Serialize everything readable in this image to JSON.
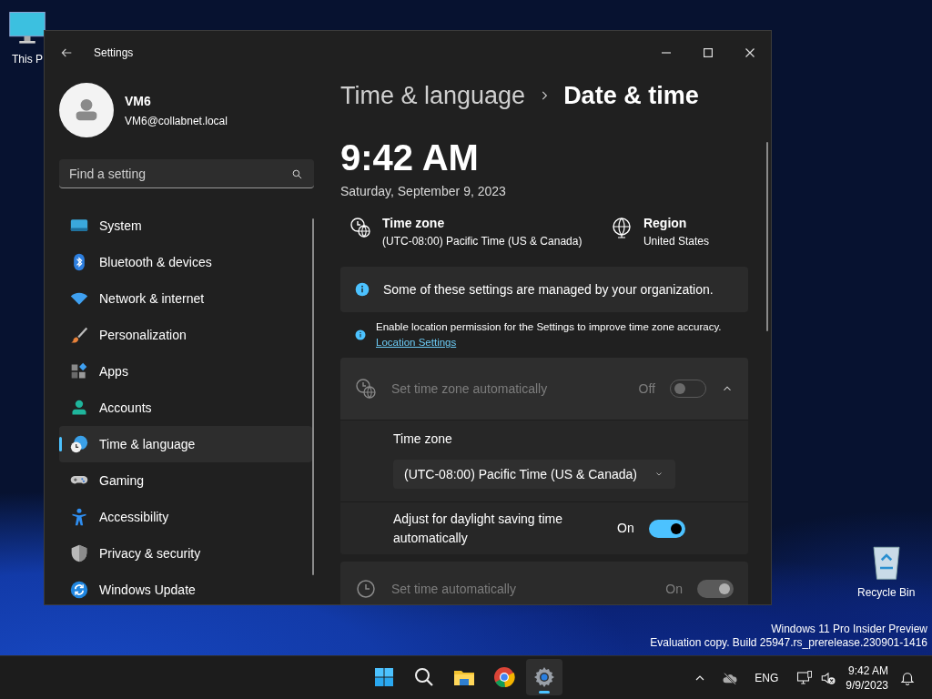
{
  "desktop": {
    "icons": [
      {
        "kind": "computer",
        "label": "This P"
      },
      {
        "kind": "recycle-bin",
        "label": "Recycle Bin"
      }
    ],
    "watermark": [
      "Windows 11 Pro Insider Preview",
      "Evaluation copy. Build 25947.rs_prerelease.230901-1416"
    ]
  },
  "window": {
    "title": "Settings",
    "account": {
      "name": "VM6",
      "email": "VM6@collabnet.local"
    },
    "search": {
      "placeholder": "Find a setting"
    },
    "nav": [
      {
        "kind": "system",
        "label": "System",
        "selected": false
      },
      {
        "kind": "bluetooth",
        "label": "Bluetooth & devices",
        "selected": false
      },
      {
        "kind": "network",
        "label": "Network & internet",
        "selected": false
      },
      {
        "kind": "personalization",
        "label": "Personalization",
        "selected": false
      },
      {
        "kind": "apps",
        "label": "Apps",
        "selected": false
      },
      {
        "kind": "accounts",
        "label": "Accounts",
        "selected": false
      },
      {
        "kind": "time",
        "label": "Time & language",
        "selected": true
      },
      {
        "kind": "gaming",
        "label": "Gaming",
        "selected": false
      },
      {
        "kind": "accessibility",
        "label": "Accessibility",
        "selected": false
      },
      {
        "kind": "privacy",
        "label": "Privacy & security",
        "selected": false
      },
      {
        "kind": "update",
        "label": "Windows Update",
        "selected": false
      }
    ],
    "page": {
      "breadcrumb": [
        "Time & language",
        "Date & time"
      ],
      "time": "9:42 AM",
      "date": "Saturday, September 9, 2023",
      "summary": [
        {
          "kind": "time-zone",
          "title": "Time zone",
          "value": "(UTC-08:00) Pacific Time (US & Canada)"
        },
        {
          "kind": "region",
          "title": "Region",
          "value": "United States"
        }
      ],
      "notice": "Some of these settings are managed by your organization.",
      "location_notice": {
        "text": "Enable location permission for the Settings to improve time zone accuracy.",
        "link": "Location Settings"
      },
      "settings": [
        {
          "kind": "expander",
          "label": "Set time zone automatically",
          "state_label": "Off",
          "on": false,
          "disabled": true,
          "expanded": true,
          "children": [
            {
              "kind": "dropdown",
              "label": "Time zone",
              "value": "(UTC-08:00) Pacific Time (US & Canada)"
            },
            {
              "kind": "toggle",
              "label": "Adjust for daylight saving time automatically",
              "state_label": "On",
              "on": true,
              "disabled": false
            }
          ]
        },
        {
          "kind": "toggle",
          "label": "Set time automatically",
          "state_label": "On",
          "on": true,
          "disabled": true
        }
      ]
    }
  },
  "taskbar": {
    "apps": [
      {
        "kind": "start",
        "selected": false
      },
      {
        "kind": "search",
        "selected": false
      },
      {
        "kind": "explorer",
        "selected": false
      },
      {
        "kind": "browser",
        "selected": false
      },
      {
        "kind": "settings",
        "selected": true
      }
    ],
    "tray": {
      "language": "ENG",
      "time": "9:42 AM",
      "date": "9/9/2023"
    }
  }
}
